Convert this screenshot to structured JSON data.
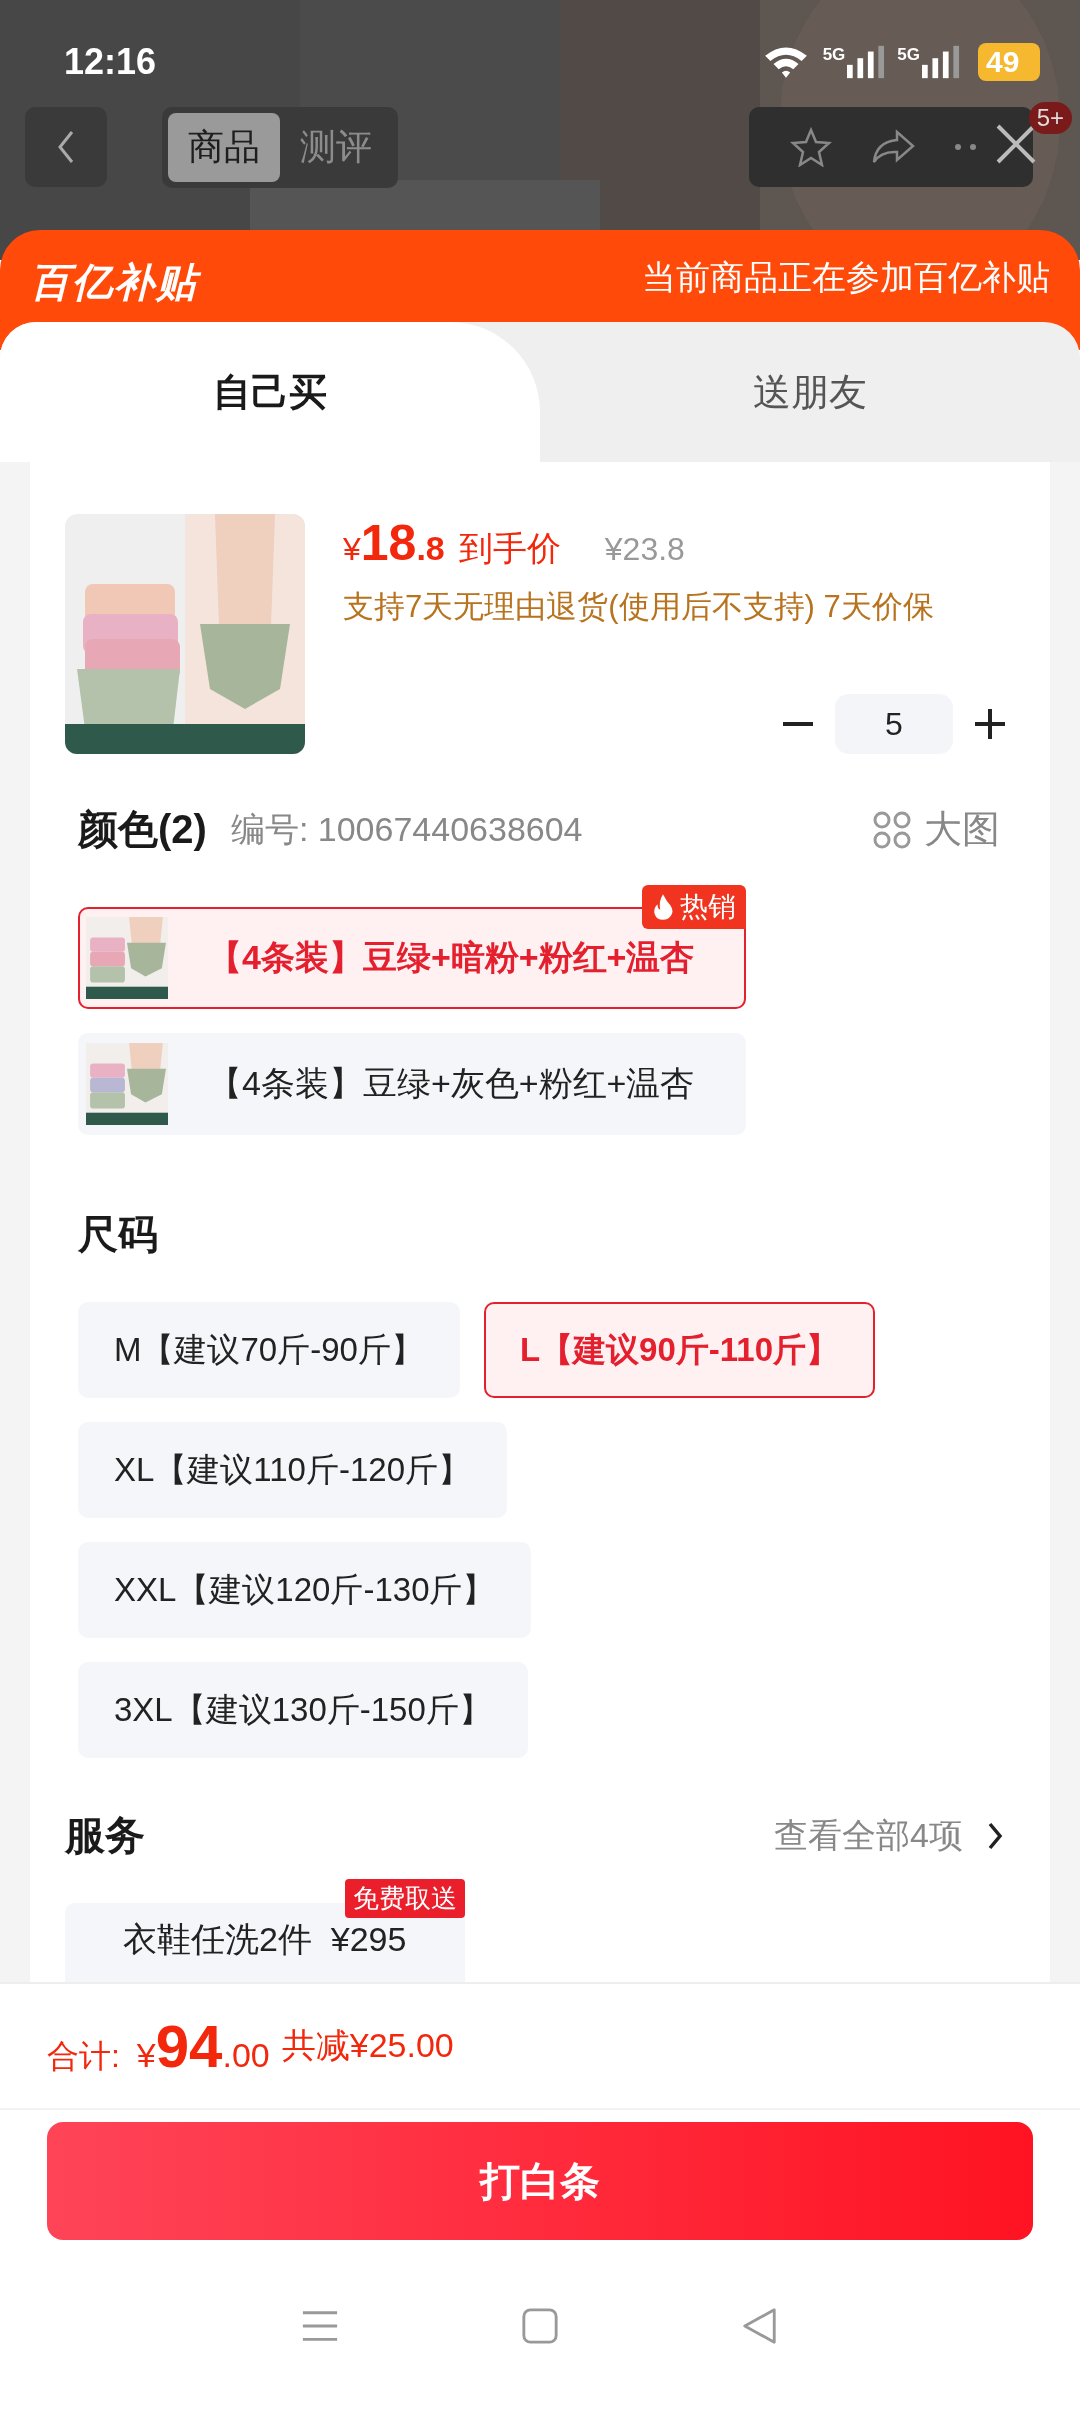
{
  "status_bar": {
    "time": "12:16",
    "network": [
      "5G",
      "5G"
    ],
    "battery": "49"
  },
  "nav": {
    "tabs": [
      {
        "label": "商品",
        "selected": true
      },
      {
        "label": "测评",
        "selected": false
      }
    ],
    "badge": "5+"
  },
  "banner": {
    "logo": "百亿补贴",
    "message": "当前商品正在参加百亿补贴"
  },
  "mode_tabs": [
    {
      "label": "自己买",
      "selected": true
    },
    {
      "label": "送朋友",
      "selected": false
    }
  ],
  "product": {
    "price": {
      "currency": "¥",
      "integer": "18",
      "decimal": ".8"
    },
    "price_label": "到手价",
    "original_price": "¥23.8",
    "guarantee": "支持7天无理由退货(使用后不支持) 7天价保",
    "quantity": "5"
  },
  "color_section": {
    "title": "颜色(2)",
    "code": "编号: 10067440638604",
    "view_large": "大图",
    "options": [
      {
        "label": "【4条装】豆绿+暗粉+粉红+温杏",
        "selected": true,
        "badge": "热销"
      },
      {
        "label": "【4条装】豆绿+灰色+粉红+温杏",
        "selected": false
      }
    ]
  },
  "size_section": {
    "title": "尺码",
    "options": [
      {
        "label": "M【建议70斤-90斤】",
        "selected": false
      },
      {
        "label": "L【建议90斤-110斤】",
        "selected": true
      },
      {
        "label": "XL【建议110斤-120斤】",
        "selected": false
      },
      {
        "label": "XXL【建议120斤-130斤】",
        "selected": false
      },
      {
        "label": "3XL【建议130斤-150斤】",
        "selected": false
      }
    ]
  },
  "services": {
    "title": "服务",
    "view_all": "查看全部4项",
    "items": [
      {
        "label": "衣鞋任洗2件  ¥295",
        "badge": "免费取送"
      }
    ]
  },
  "footer": {
    "total_label": "合计:",
    "total": {
      "currency": "¥",
      "integer": "94",
      "decimal": ".00"
    },
    "discount": "共减¥25.00",
    "button": "打白条"
  }
}
